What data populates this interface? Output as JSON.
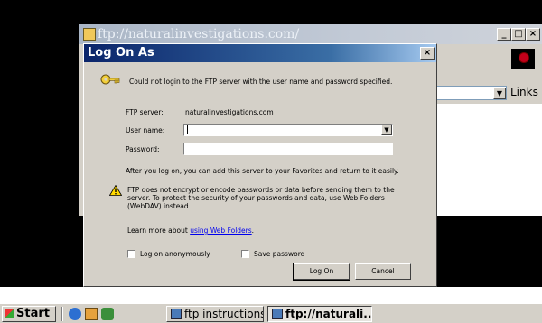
{
  "ie_window": {
    "title": "ftp://naturalinvestigations.com/",
    "min_glyph": "_",
    "max_glyph": "□",
    "close_glyph": "×",
    "links_label": "Links",
    "links_chevron": "»",
    "addr_drop_glyph": "▼"
  },
  "dialog": {
    "title": "Log On As",
    "close_glyph": "×",
    "message": "Could not login to the FTP server with the user name and password specified.",
    "ftp_server_label": "FTP server:",
    "ftp_server_value": "naturalinvestigations.com",
    "user_name_label": "User name:",
    "user_name_value": "",
    "combo_drop_glyph": "▼",
    "password_label": "Password:",
    "password_value": "",
    "favorites_note": "After you log on, you can add this server to your Favorites and return to it easily.",
    "warning_text": "FTP does not encrypt or encode passwords or data before sending them to the server.  To protect the security of your passwords and data, use Web Folders (WebDAV) instead.",
    "learn_more_prefix": "Learn more about ",
    "learn_more_link": "using Web Folders",
    "learn_more_suffix": ".",
    "anonymous_label": "Log on anonymously",
    "anonymous_checked": false,
    "save_password_label": "Save password",
    "save_password_checked": false,
    "log_on_button": "Log On",
    "cancel_button": "Cancel"
  },
  "taskbar": {
    "start_label": "Start",
    "tasks": [
      {
        "label": "ftp instructions....",
        "active": false
      },
      {
        "label": "ftp://naturali...",
        "active": true
      }
    ]
  }
}
